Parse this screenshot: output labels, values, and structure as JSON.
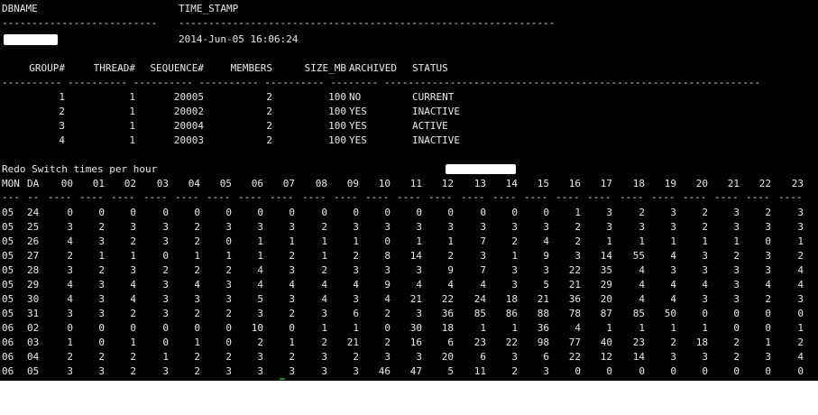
{
  "db_header": {
    "dbname_label": "DBNAME",
    "timestamp_label": "TIME_STAMP",
    "dbname_dashes": "--------------------------",
    "timestamp_dashes": "---------------------------------------------------------------",
    "timestamp_value": "2014-Jun-05 16:06:24"
  },
  "log_table": {
    "headers": [
      "GROUP#",
      "THREAD#",
      "SEQUENCE#",
      "MEMBERS",
      "SIZE_MB",
      "ARCHIVED",
      "STATUS"
    ],
    "dashes": "---------- ---------- ---------- ---------- ---------- -------- ---------------------------------------------------------------",
    "rows": [
      [
        "1",
        "1",
        "20005",
        "2",
        "100",
        "NO",
        "CURRENT"
      ],
      [
        "2",
        "1",
        "20002",
        "2",
        "100",
        "YES",
        "INACTIVE"
      ],
      [
        "3",
        "1",
        "20004",
        "2",
        "100",
        "YES",
        "ACTIVE"
      ],
      [
        "4",
        "1",
        "20003",
        "2",
        "100",
        "YES",
        "INACTIVE"
      ]
    ]
  },
  "redo": {
    "title": "Redo Switch times per hour",
    "mon_label": "MON",
    "da_label": "DA",
    "hours": [
      "00",
      "01",
      "02",
      "03",
      "04",
      "05",
      "06",
      "07",
      "08",
      "09",
      "10",
      "11",
      "12",
      "13",
      "14",
      "15",
      "16",
      "17",
      "18",
      "19",
      "20",
      "21",
      "22",
      "23"
    ],
    "dashes_mon": "---",
    "dashes_da": "--",
    "dashes_hour": "----",
    "rows": [
      {
        "mon": "05",
        "da": "24",
        "v": [
          "0",
          "0",
          "0",
          "0",
          "0",
          "0",
          "0",
          "0",
          "0",
          "0",
          "0",
          "0",
          "0",
          "0",
          "0",
          "0",
          "1",
          "3",
          "2",
          "3",
          "2",
          "3",
          "2",
          "3"
        ]
      },
      {
        "mon": "05",
        "da": "25",
        "v": [
          "3",
          "2",
          "3",
          "3",
          "2",
          "3",
          "3",
          "3",
          "2",
          "3",
          "3",
          "3",
          "3",
          "3",
          "3",
          "3",
          "2",
          "3",
          "3",
          "3",
          "2",
          "3",
          "3",
          "3"
        ]
      },
      {
        "mon": "05",
        "da": "26",
        "v": [
          "4",
          "3",
          "2",
          "3",
          "2",
          "0",
          "1",
          "1",
          "1",
          "1",
          "0",
          "1",
          "1",
          "7",
          "2",
          "4",
          "2",
          "1",
          "1",
          "1",
          "1",
          "1",
          "0",
          "1"
        ]
      },
      {
        "mon": "05",
        "da": "27",
        "v": [
          "2",
          "1",
          "1",
          "0",
          "1",
          "1",
          "1",
          "2",
          "1",
          "2",
          "8",
          "14",
          "2",
          "3",
          "1",
          "9",
          "3",
          "14",
          "55",
          "4",
          "3",
          "2",
          "3",
          "2"
        ]
      },
      {
        "mon": "05",
        "da": "28",
        "v": [
          "3",
          "2",
          "3",
          "2",
          "2",
          "2",
          "4",
          "3",
          "2",
          "3",
          "3",
          "3",
          "9",
          "7",
          "3",
          "3",
          "22",
          "35",
          "4",
          "3",
          "3",
          "3",
          "3",
          "4"
        ]
      },
      {
        "mon": "05",
        "da": "29",
        "v": [
          "4",
          "3",
          "4",
          "3",
          "4",
          "3",
          "4",
          "4",
          "4",
          "4",
          "9",
          "4",
          "4",
          "4",
          "3",
          "5",
          "21",
          "29",
          "4",
          "4",
          "4",
          "3",
          "4",
          "4"
        ]
      },
      {
        "mon": "05",
        "da": "30",
        "v": [
          "4",
          "3",
          "4",
          "3",
          "3",
          "3",
          "5",
          "3",
          "4",
          "3",
          "4",
          "21",
          "22",
          "24",
          "18",
          "21",
          "36",
          "20",
          "4",
          "4",
          "3",
          "3",
          "2",
          "3"
        ]
      },
      {
        "mon": "05",
        "da": "31",
        "v": [
          "3",
          "3",
          "2",
          "3",
          "2",
          "2",
          "3",
          "2",
          "3",
          "6",
          "2",
          "3",
          "36",
          "85",
          "86",
          "88",
          "78",
          "87",
          "85",
          "50",
          "0",
          "0",
          "0",
          "0"
        ]
      },
      {
        "mon": "06",
        "da": "02",
        "v": [
          "0",
          "0",
          "0",
          "0",
          "0",
          "0",
          "10",
          "0",
          "1",
          "1",
          "0",
          "30",
          "18",
          "1",
          "1",
          "36",
          "4",
          "1",
          "1",
          "1",
          "1",
          "0",
          "0",
          "1"
        ]
      },
      {
        "mon": "06",
        "da": "03",
        "v": [
          "1",
          "0",
          "1",
          "0",
          "1",
          "0",
          "2",
          "1",
          "2",
          "21",
          "2",
          "16",
          "6",
          "23",
          "22",
          "98",
          "77",
          "40",
          "23",
          "2",
          "18",
          "2",
          "1",
          "2"
        ]
      },
      {
        "mon": "06",
        "da": "04",
        "v": [
          "2",
          "2",
          "2",
          "1",
          "2",
          "2",
          "3",
          "2",
          "3",
          "2",
          "3",
          "3",
          "20",
          "6",
          "3",
          "6",
          "22",
          "12",
          "14",
          "3",
          "3",
          "2",
          "3",
          "4"
        ]
      },
      {
        "mon": "06",
        "da": "05",
        "v": [
          "3",
          "3",
          "2",
          "3",
          "2",
          "3",
          "3",
          "3",
          "3",
          "3",
          "46",
          "47",
          "5",
          "11",
          "2",
          "3",
          "0",
          "0",
          "0",
          "0",
          "0",
          "0",
          "0",
          "0"
        ]
      }
    ]
  }
}
